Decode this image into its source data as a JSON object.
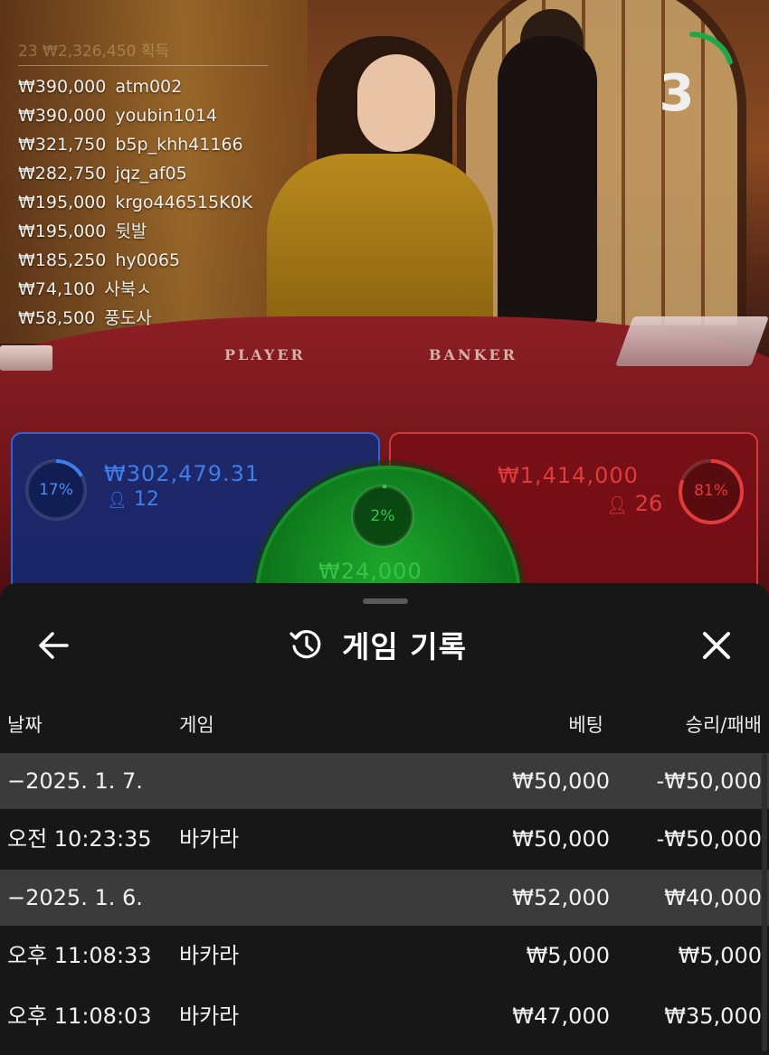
{
  "winners": {
    "header": "23 ₩2,326,450 획득",
    "list": [
      {
        "amount": "₩390,000",
        "user": "atm002"
      },
      {
        "amount": "₩390,000",
        "user": "youbin1014"
      },
      {
        "amount": "₩321,750",
        "user": "b5p_khh41166"
      },
      {
        "amount": "₩282,750",
        "user": "jqz_af05"
      },
      {
        "amount": "₩195,000",
        "user": "krgo446515K0K"
      },
      {
        "amount": "₩195,000",
        "user": "뒷발"
      },
      {
        "amount": "₩185,250",
        "user": "hy0065"
      },
      {
        "amount": "₩74,100",
        "user": "사북ㅅ"
      },
      {
        "amount": "₩58,500",
        "user": "풍도사"
      }
    ]
  },
  "table": {
    "player_label": "PLAYER",
    "banker_label": "BANKER"
  },
  "countdown": {
    "value": "3",
    "fraction": 0.2,
    "color": "#1fa84a"
  },
  "bets": {
    "player": {
      "percent_label": "17%",
      "percent": 17,
      "amount": "₩302,479.31",
      "players": "12",
      "color": "#3d7ee8"
    },
    "banker": {
      "percent_label": "81%",
      "percent": 81,
      "amount": "₩1,414,000",
      "players": "26",
      "color": "#e23b3b"
    },
    "tie": {
      "percent_label": "2%",
      "percent": 2,
      "amount": "₩24,000",
      "color": "#36c34a"
    }
  },
  "history": {
    "title": "게임 기록",
    "back_icon": "arrow-left-icon",
    "title_icon": "history-icon",
    "close_icon": "close-icon",
    "columns": {
      "date": "날짜",
      "game": "게임",
      "bet": "베팅",
      "win_loss": "승리/패배"
    },
    "groups": [
      {
        "date": "−2025. 1. 7.",
        "bet": "₩50,000",
        "win_loss": "-₩50,000",
        "rows": [
          {
            "time": "오전 10:23:35",
            "game": "바카라",
            "bet": "₩50,000",
            "win_loss": "-₩50,000"
          }
        ]
      },
      {
        "date": "−2025. 1. 6.",
        "bet": "₩52,000",
        "win_loss": "₩40,000",
        "rows": [
          {
            "time": "오후 11:08:33",
            "game": "바카라",
            "bet": "₩5,000",
            "win_loss": "₩5,000"
          },
          {
            "time": "오후 11:08:03",
            "game": "바카라",
            "bet": "₩47,000",
            "win_loss": "₩35,000"
          }
        ]
      }
    ]
  }
}
